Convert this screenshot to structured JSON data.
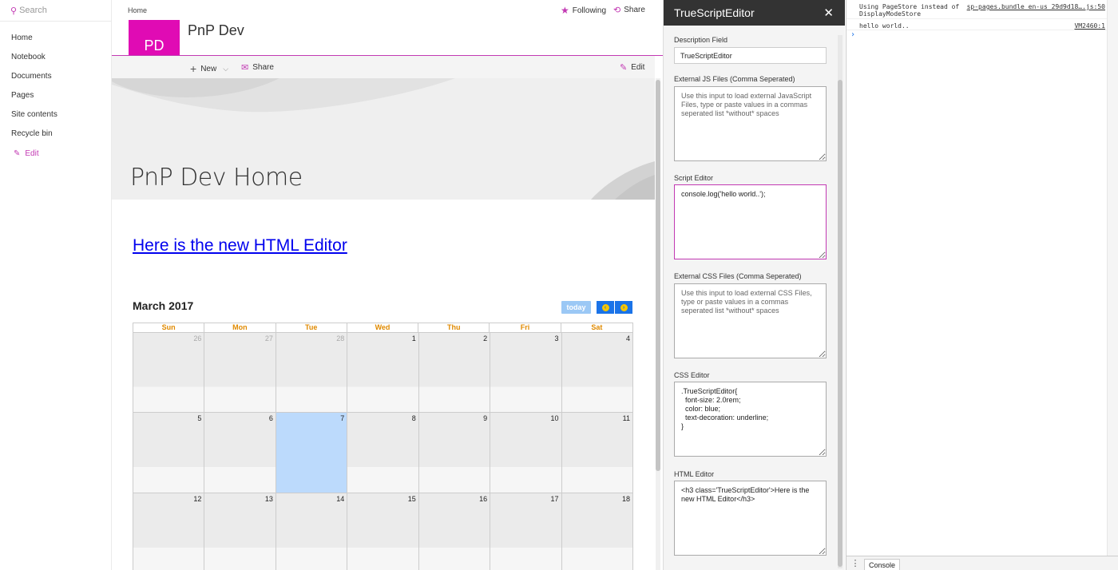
{
  "nav": {
    "search_placeholder": "Search",
    "items": [
      "Home",
      "Notebook",
      "Documents",
      "Pages",
      "Site contents",
      "Recycle bin"
    ],
    "edit_label": "Edit"
  },
  "header": {
    "breadcrumb": "Home",
    "following": "Following",
    "share": "Share",
    "logo_initials": "PD",
    "site_title": "PnP Dev"
  },
  "commandbar": {
    "new_label": "New",
    "share_label": "Share",
    "edit_label": "Edit"
  },
  "hero": {
    "title": "PnP Dev Home"
  },
  "content": {
    "link_text": "Here is the new HTML Editor"
  },
  "calendar": {
    "title": "March 2017",
    "today_label": "today",
    "days": [
      "Sun",
      "Mon",
      "Tue",
      "Wed",
      "Thu",
      "Fri",
      "Sat"
    ],
    "weeks": [
      [
        "26",
        "27",
        "28",
        "1",
        "2",
        "3",
        "4"
      ],
      [
        "5",
        "6",
        "7",
        "8",
        "9",
        "10",
        "11"
      ],
      [
        "12",
        "13",
        "14",
        "15",
        "16",
        "17",
        "18"
      ]
    ]
  },
  "panel": {
    "title": "TrueScriptEditor",
    "description_label": "Description Field",
    "description_value": "TrueScriptEditor",
    "js_label": "External JS Files (Comma Seperated)",
    "js_placeholder": "Use this input to load external JavaScript Files, type or paste values in a commas seperated list *without* spaces",
    "script_label": "Script Editor",
    "script_value": "console.log('hello world..');",
    "css_files_label": "External CSS Files (Comma Seperated)",
    "css_files_placeholder": "Use this input to load external CSS Files, type or paste values in a commas seperated list *without* spaces",
    "css_editor_label": "CSS Editor",
    "css_editor_value": ".TrueScriptEditor{\n  font-size: 2.0rem;\n  color: blue;\n  text-decoration: underline;\n}",
    "html_editor_label": "HTML Editor",
    "html_editor_value": "<h3 class='TrueScriptEditor'>Here is the new HTML Editor</h3>"
  },
  "devtools": {
    "messages": [
      {
        "text": "Using PageStore instead of\nDisplayModeStore",
        "source": "sp-pages.bundle_en-us_29d9d18….js:50"
      },
      {
        "text": "hello world..",
        "source": "VM2460:1"
      }
    ],
    "drawer_tab": "Console"
  },
  "colors": {
    "accent": "#c239b3",
    "logo_bg": "#e00bb4",
    "today_cell": "#bcdafc",
    "link": "#0000ee"
  }
}
